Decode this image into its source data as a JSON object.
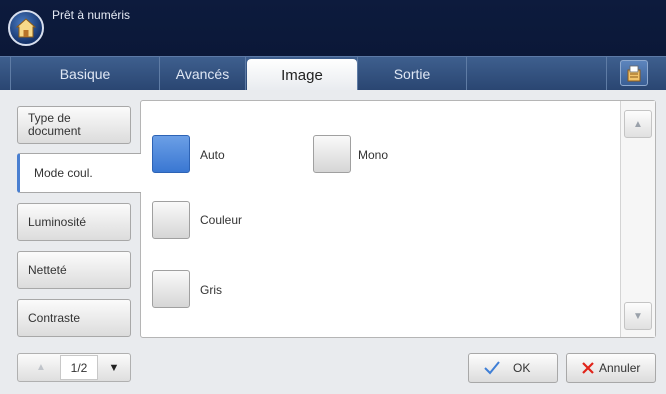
{
  "header": {
    "title": "Prêt à numéris"
  },
  "tabs": [
    {
      "label": "Basique"
    },
    {
      "label": "Avancés"
    },
    {
      "label": "Image"
    },
    {
      "label": "Sortie"
    }
  ],
  "sidebar": {
    "items": [
      {
        "label": "Type de\ndocument"
      },
      {
        "label": "Mode coul."
      },
      {
        "label": "Luminosité"
      },
      {
        "label": "Netteté"
      },
      {
        "label": "Contraste"
      }
    ]
  },
  "options": [
    {
      "label": "Auto",
      "selected": true
    },
    {
      "label": "Mono",
      "selected": false
    },
    {
      "label": "Couleur",
      "selected": false
    },
    {
      "label": "Gris",
      "selected": false
    }
  ],
  "pager": {
    "text": "1/2"
  },
  "actions": {
    "ok_label": "OK",
    "cancel_label": "Annuler"
  },
  "colors": {
    "accent": "#4a7fd0",
    "header_bg": "#0d1b3d",
    "tab_bg": "#34537f",
    "selected_option": "#4a86dd"
  },
  "icons": [
    "home-icon",
    "clipboard-icon",
    "scroll-up-icon",
    "scroll-down-icon",
    "pager-up-icon",
    "pager-down-icon",
    "check-icon",
    "cross-icon"
  ]
}
